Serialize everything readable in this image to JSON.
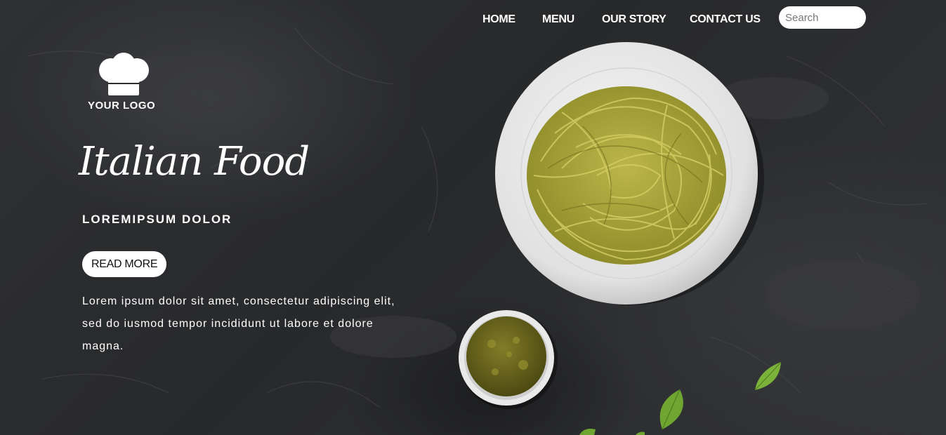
{
  "nav": {
    "home": "HOME",
    "menu": "MENU",
    "our_story": "OUR STORY",
    "contact_us": "CONTACT US"
  },
  "search": {
    "placeholder": "Search",
    "value": ""
  },
  "logo": {
    "text": "YOUR LOGO",
    "icon": "chef-hat-icon"
  },
  "hero": {
    "title": "Italian Food",
    "subtitle": "LOREMIPSUM DOLOR",
    "cta": "READ MORE",
    "description": "Lorem ipsum dolor sit amet, consectetur adipiscing elit, sed do iusmod tempor incididunt ut labore et dolore magna."
  },
  "colors": {
    "background": "#2b2c2e",
    "text": "#ffffff",
    "pasta": "#a9a63a",
    "pesto": "#6e6a1c",
    "basil": "#6fa531"
  }
}
